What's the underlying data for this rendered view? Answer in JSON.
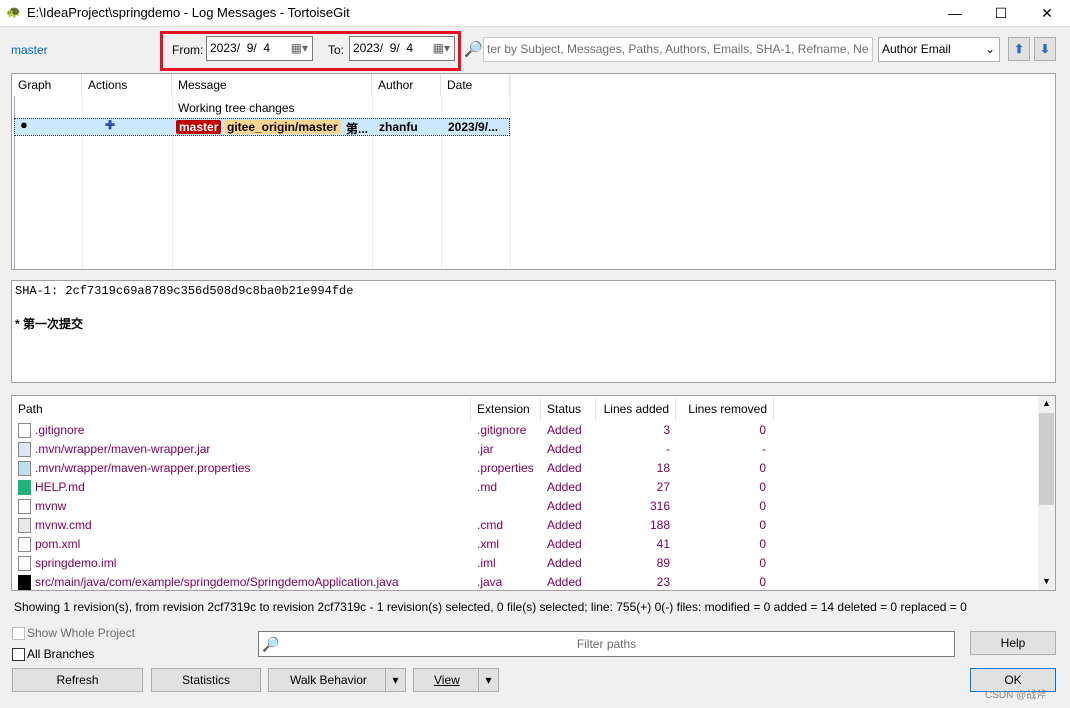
{
  "window": {
    "title": "E:\\IdeaProject\\springdemo - Log Messages - TortoiseGit",
    "minimize": "—",
    "maximize": "☐",
    "close": "✕"
  },
  "toolbar": {
    "branch": "master",
    "from_label": "From:",
    "from_date": "2023/  9/  4",
    "to_label": "To:",
    "to_date": "2023/  9/  4",
    "search_placeholder": "ter by Subject, Messages, Paths, Authors, Emails, SHA-1, Refname, Ne",
    "filter_field": "Author Email",
    "accent": "#e81123"
  },
  "log": {
    "columns": [
      "Graph",
      "Actions",
      "Message",
      "Author",
      "Date"
    ],
    "working_tree": "Working tree changes",
    "rows": [
      {
        "tags": [
          {
            "name": "master",
            "color": "#c00000"
          },
          {
            "name": "gitee_origin/master",
            "color": "#ffd58f"
          }
        ],
        "message": "第...",
        "author": "zhanfu",
        "date": "2023/9/..."
      }
    ]
  },
  "details": {
    "sha": "SHA-1: 2cf7319c69a8789c356d508d9c8ba0b21e994fde",
    "message": "* 第一次提交"
  },
  "files": {
    "columns": [
      "Path",
      "Extension",
      "Status",
      "Lines added",
      "Lines removed"
    ],
    "rows": [
      {
        "path": ".gitignore",
        "ext": ".gitignore",
        "status": "Added",
        "added": "3",
        "removed": "0",
        "icon": "text-file-icon"
      },
      {
        "path": ".mvn/wrapper/maven-wrapper.jar",
        "ext": ".jar",
        "status": "Added",
        "added": "-",
        "removed": "-",
        "icon": "java-jar-icon"
      },
      {
        "path": ".mvn/wrapper/maven-wrapper.properties",
        "ext": ".properties",
        "status": "Added",
        "added": "18",
        "removed": "0",
        "icon": "properties-file-icon"
      },
      {
        "path": "HELP.md",
        "ext": ".md",
        "status": "Added",
        "added": "27",
        "removed": "0",
        "icon": "markdown-file-icon"
      },
      {
        "path": "mvnw",
        "ext": "",
        "status": "Added",
        "added": "316",
        "removed": "0",
        "icon": "file-icon"
      },
      {
        "path": "mvnw.cmd",
        "ext": ".cmd",
        "status": "Added",
        "added": "188",
        "removed": "0",
        "icon": "cmd-file-icon"
      },
      {
        "path": "pom.xml",
        "ext": ".xml",
        "status": "Added",
        "added": "41",
        "removed": "0",
        "icon": "file-icon"
      },
      {
        "path": "springdemo.iml",
        "ext": ".iml",
        "status": "Added",
        "added": "89",
        "removed": "0",
        "icon": "file-icon"
      },
      {
        "path": "src/main/java/com/example/springdemo/SpringdemoApplication.java",
        "ext": ".java",
        "status": "Added",
        "added": "23",
        "removed": "0",
        "icon": "intellij-file-icon"
      }
    ]
  },
  "status": "Showing 1 revision(s), from revision 2cf7319c to revision 2cf7319c - 1 revision(s) selected, 0 file(s) selected; line: 755(+) 0(-) files: modified = 0 added = 14 deleted = 0 replaced = 0",
  "bottom": {
    "show_whole_project": "Show Whole Project",
    "all_branches": "All Branches",
    "filter_paths": "Filter paths",
    "help": "Help",
    "refresh": "Refresh",
    "statistics": "Statistics",
    "walk_behavior": "Walk Behavior",
    "view": "View",
    "ok": "OK",
    "watermark": "CSDN @战斧"
  }
}
